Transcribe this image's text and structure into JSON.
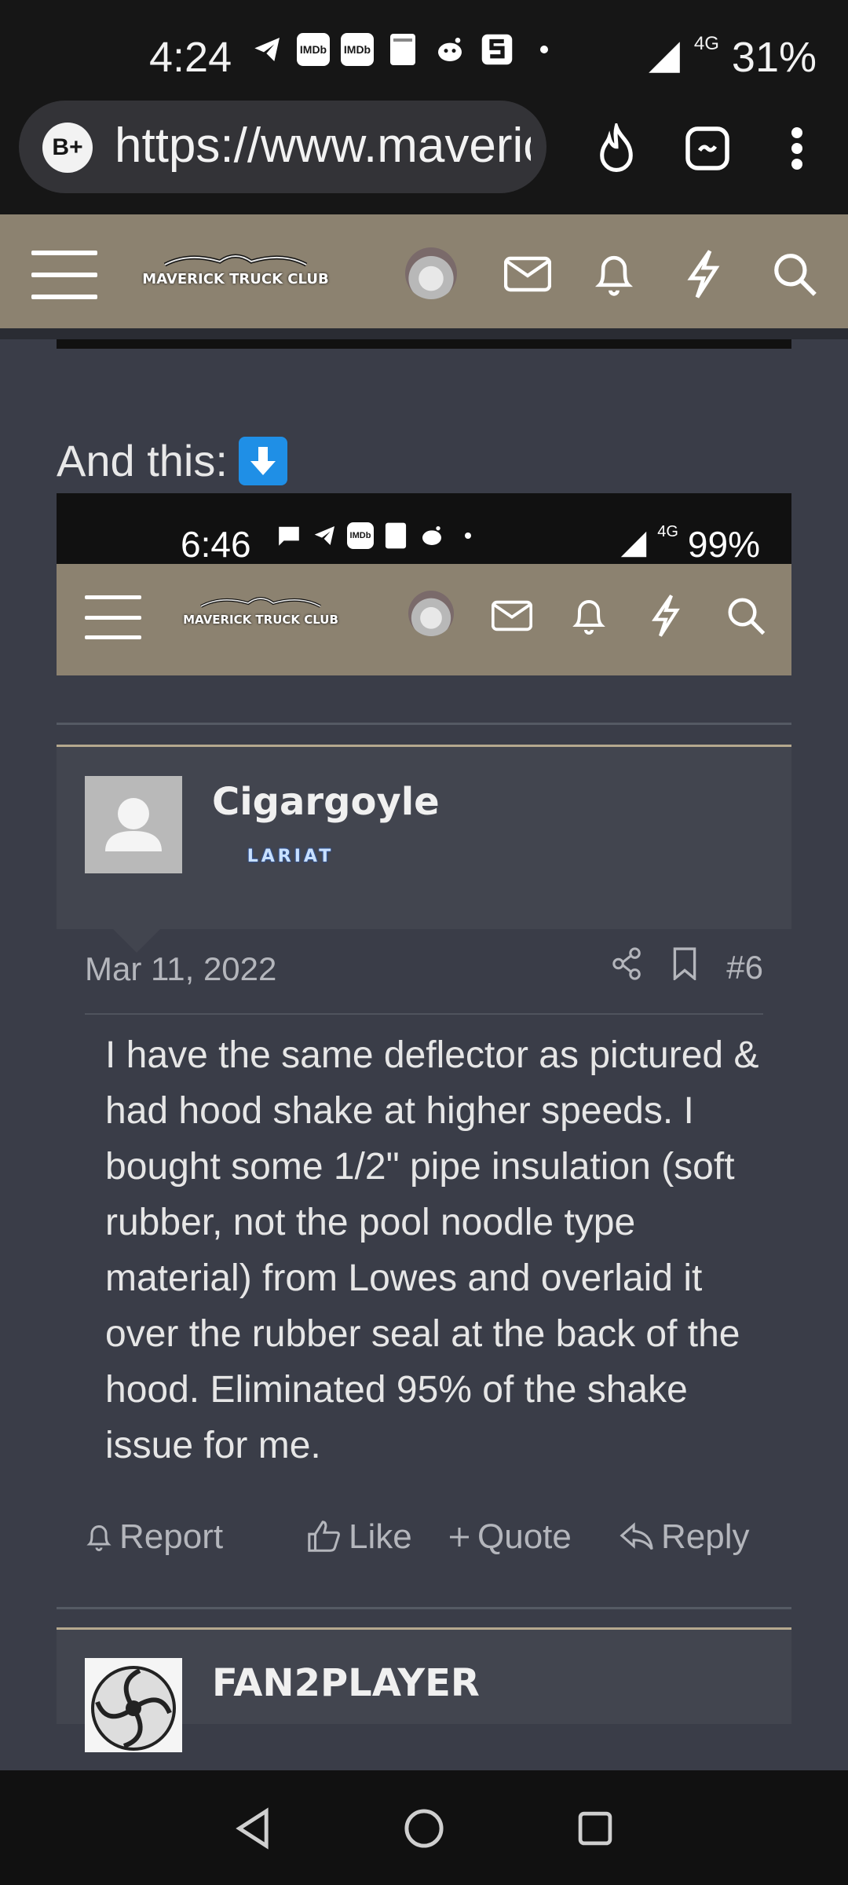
{
  "status_bar": {
    "time": "4:24",
    "network": "4G",
    "battery": "31%",
    "notification_icons": [
      "telegram-icon",
      "imdb-icon",
      "imdb-icon",
      "bible-icon",
      "reddit-icon",
      "s-app-icon",
      "dot-icon"
    ],
    "imdb_label": "IMDb"
  },
  "browser": {
    "badge": "B+",
    "url": "https://www.maverickpartsclub.com"
  },
  "site": {
    "logo_text": "MAVERICK TRUCK CLUB"
  },
  "intro_text": "And this:",
  "embedded_screenshot": {
    "time": "6:46",
    "network": "4G",
    "battery": "99%",
    "logo_text": "MAVERICK TRUCK CLUB"
  },
  "post": {
    "username": "Cigargoyle",
    "user_title": "LARIAT",
    "date": "Mar 11, 2022",
    "post_number": "#6",
    "body": "I have the same deflector as pictured & had hood shake at higher speeds. I bought some 1/2\" pipe insulation (soft rubber, not the pool noodle type material) from Lowes and overlaid it over the rubber seal at the back of the hood. Eliminated 95% of the shake issue for me.",
    "actions": {
      "report": "Report",
      "like": "Like",
      "quote": "Quote",
      "reply": "Reply"
    }
  },
  "next_post": {
    "username": "FAN2PLAYER"
  },
  "colors": {
    "header": "#8c8270",
    "background": "#3a3d48",
    "accent_line": "#b5a88e"
  }
}
